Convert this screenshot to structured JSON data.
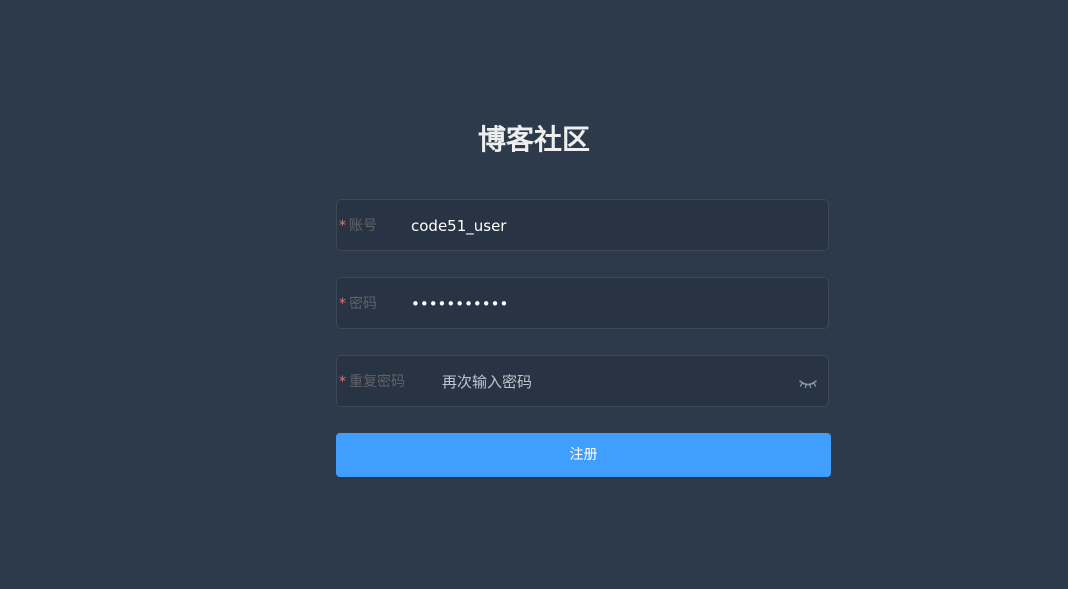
{
  "title": "博客社区",
  "form": {
    "account": {
      "required_mark": "*",
      "label": "账号",
      "value": "code51_user"
    },
    "password": {
      "required_mark": "*",
      "label": "密码",
      "value": "•••••••••••"
    },
    "confirm_password": {
      "required_mark": "*",
      "label": "重复密码",
      "placeholder": "再次输入密码",
      "icon": "eye-closed-icon"
    },
    "submit_label": "注册"
  },
  "colors": {
    "background": "#2d3a4b",
    "input_background": "#283443",
    "accent": "#409eff",
    "required": "#f56c6c"
  }
}
